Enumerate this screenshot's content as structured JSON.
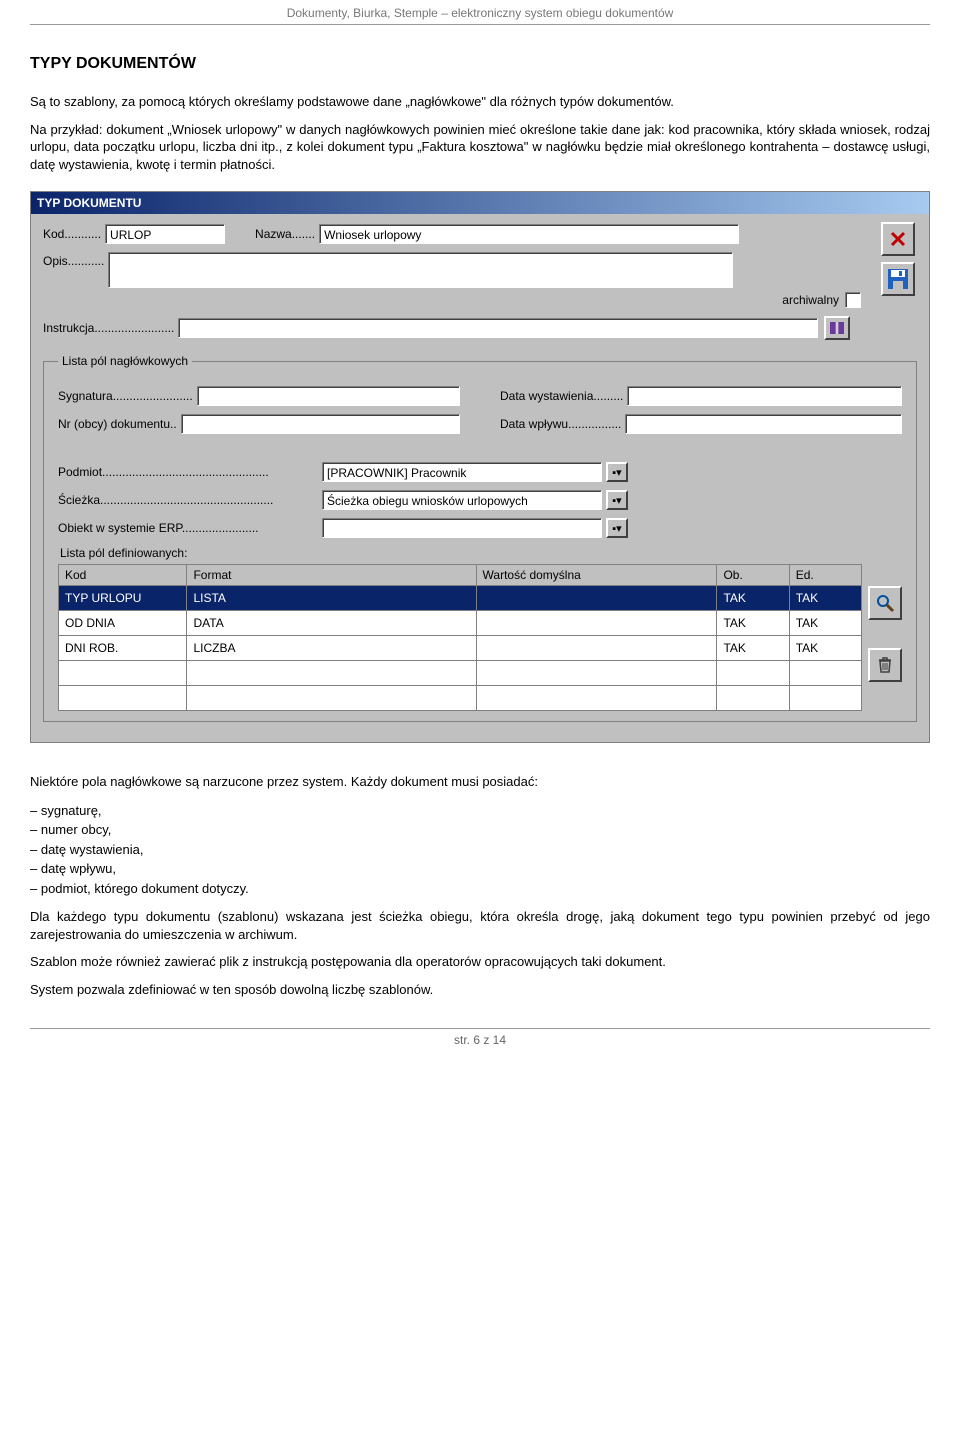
{
  "doc_header": "Dokumenty, Biurka, Stemple – elektroniczny system obiegu dokumentów",
  "section_title": "TYPY DOKUMENTÓW",
  "para1": "Są to szablony, za pomocą których określamy podstawowe dane „nagłówkowe\" dla różnych typów dokumentów.",
  "para2": "Na przykład: dokument „Wniosek urlopowy\" w danych nagłówkowych powinien mieć określone takie dane jak: kod pracownika, który składa wniosek, rodzaj urlopu, data początku urlopu, liczba dni itp., z kolei dokument typu „Faktura kosztowa\" w nagłówku będzie miał określonego kontrahenta – dostawcę usługi, datę wystawienia, kwotę i termin płatności.",
  "window": {
    "title": "TYP DOKUMENTU",
    "labels": {
      "kod": "Kod...........",
      "nazwa": "Nazwa.......",
      "opis": "Opis...........",
      "archiwalny": "archiwalny",
      "instrukcja": "Instrukcja........................",
      "legend_header": "Lista pól nagłówkowych",
      "sygnatura": "Sygnatura........................",
      "data_wyst": "Data wystawienia.........",
      "nr_obcy": "Nr (obcy) dokumentu..",
      "data_wpl": "Data wpływu................",
      "podmiot": "Podmiot..................................................",
      "sciezka": "Ścieżka....................................................",
      "obiekt": "Obiekt w systemie ERP.......................",
      "def_list": "Lista pól definiowanych:"
    },
    "values": {
      "kod": "URLOP",
      "nazwa": "Wniosek urlopowy",
      "opis": "",
      "instrukcja": "",
      "sygnatura": "",
      "data_wyst": "",
      "nr_obcy": "",
      "data_wpl": "",
      "podmiot": "[PRACOWNIK] Pracownik",
      "sciezka": "Ścieżka obiegu wniosków urlopowych",
      "obiekt": ""
    },
    "table": {
      "headers": [
        "Kod",
        "Format",
        "Wartość domyślna",
        "Ob.",
        "Ed."
      ],
      "rows": [
        {
          "kod": "TYP URLOPU",
          "format": "LISTA",
          "wartosc": "",
          "ob": "TAK",
          "ed": "TAK",
          "selected": true
        },
        {
          "kod": "OD DNIA",
          "format": "DATA",
          "wartosc": "",
          "ob": "TAK",
          "ed": "TAK",
          "selected": false
        },
        {
          "kod": "DNI ROB.",
          "format": "LICZBA",
          "wartosc": "",
          "ob": "TAK",
          "ed": "TAK",
          "selected": false
        },
        {
          "kod": "",
          "format": "",
          "wartosc": "",
          "ob": "",
          "ed": "",
          "selected": false
        },
        {
          "kod": "",
          "format": "",
          "wartosc": "",
          "ob": "",
          "ed": "",
          "selected": false
        }
      ]
    }
  },
  "after_para_intro": "Niektóre pola nagłówkowe są narzucone przez system. Każdy dokument musi posiadać:",
  "bullets": [
    "sygnaturę,",
    "numer obcy,",
    "datę wystawienia,",
    "datę wpływu,",
    "podmiot, którego dokument dotyczy."
  ],
  "after_para2": "Dla każdego typu dokumentu (szablonu) wskazana jest ścieżka obiegu, która określa drogę, jaką dokument tego typu powinien przebyć od jego zarejestrowania do umieszczenia w archiwum.",
  "after_para3": "Szablon może również zawierać plik z instrukcją postępowania dla operatorów opracowujących taki dokument.",
  "after_para4": "System pozwala zdefiniować w ten sposób dowolną liczbę szablonów.",
  "footer": "str. 6 z 14"
}
